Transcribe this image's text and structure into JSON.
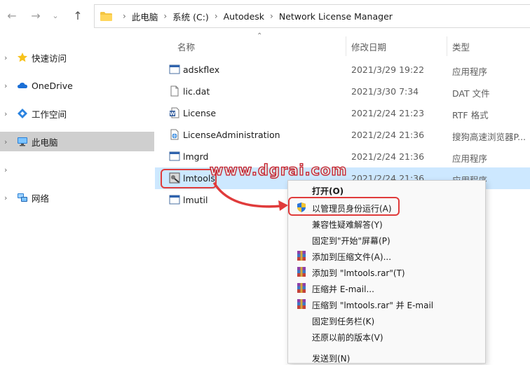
{
  "nav": {
    "back_icon": "arrow-left-icon",
    "forward_icon": "arrow-right-icon",
    "expand_icon": "chevron-down-icon",
    "up_icon": "arrow-up-icon"
  },
  "breadcrumb": [
    "此电脑",
    "系统 (C:)",
    "Autodesk",
    "Network License Manager"
  ],
  "sidebar": {
    "items": [
      {
        "label": "快速访问",
        "icon": "star-icon"
      },
      {
        "label": "OneDrive",
        "icon": "cloud-icon"
      },
      {
        "label": "工作空间",
        "icon": "workspace-icon"
      },
      {
        "label": "此电脑",
        "icon": "computer-icon",
        "selected": true
      },
      {
        "label": "",
        "icon": ""
      },
      {
        "label": "网络",
        "icon": "network-icon"
      }
    ]
  },
  "columns": {
    "name": "名称",
    "date": "修改日期",
    "type": "类型"
  },
  "files": [
    {
      "name": "adskflex",
      "date": "2021/3/29 19:22",
      "type": "应用程序",
      "icon": "application-icon"
    },
    {
      "name": "lic.dat",
      "date": "2021/3/30 7:34",
      "type": "DAT 文件",
      "icon": "file-icon"
    },
    {
      "name": "License",
      "date": "2021/2/24 21:23",
      "type": "RTF 格式",
      "icon": "word-document-icon"
    },
    {
      "name": "LicenseAdministration",
      "date": "2021/2/24 21:36",
      "type": "搜狗高速浏览器P...",
      "icon": "html-document-icon"
    },
    {
      "name": "lmgrd",
      "date": "2021/2/24 21:36",
      "type": "应用程序",
      "icon": "application-icon"
    },
    {
      "name": "lmtools",
      "date": "2021/2/24 21:36",
      "type": "应用程序",
      "icon": "lmtools-icon",
      "selected": true
    },
    {
      "name": "lmutil",
      "date": "",
      "type": "",
      "icon": "application-icon"
    }
  ],
  "context_menu": {
    "items": [
      {
        "label": "打开(O)",
        "icon": "",
        "bold": true
      },
      {
        "label": "以管理员身份运行(A)",
        "icon": "uac-shield-icon"
      },
      {
        "label": "兼容性疑难解答(Y)",
        "icon": ""
      },
      {
        "label": "固定到\"开始\"屏幕(P)",
        "icon": ""
      },
      {
        "label": "添加到压缩文件(A)...",
        "icon": "winrar-icon"
      },
      {
        "label": "添加到 \"lmtools.rar\"(T)",
        "icon": "winrar-icon"
      },
      {
        "label": "压缩并 E-mail...",
        "icon": "winrar-icon"
      },
      {
        "label": "压缩到 \"lmtools.rar\" 并 E-mail",
        "icon": "winrar-icon"
      },
      {
        "label": "固定到任务栏(K)",
        "icon": ""
      },
      {
        "label": "还原以前的版本(V)",
        "icon": ""
      },
      {
        "label": "发送到(N)",
        "icon": ""
      }
    ]
  },
  "watermark": "www.dgrai.com",
  "colors": {
    "selection": "#cde8ff",
    "sidebar_selected": "#cfcfcf",
    "annotation_red": "#e03b3b",
    "menu_bg": "#f9f9f9"
  }
}
